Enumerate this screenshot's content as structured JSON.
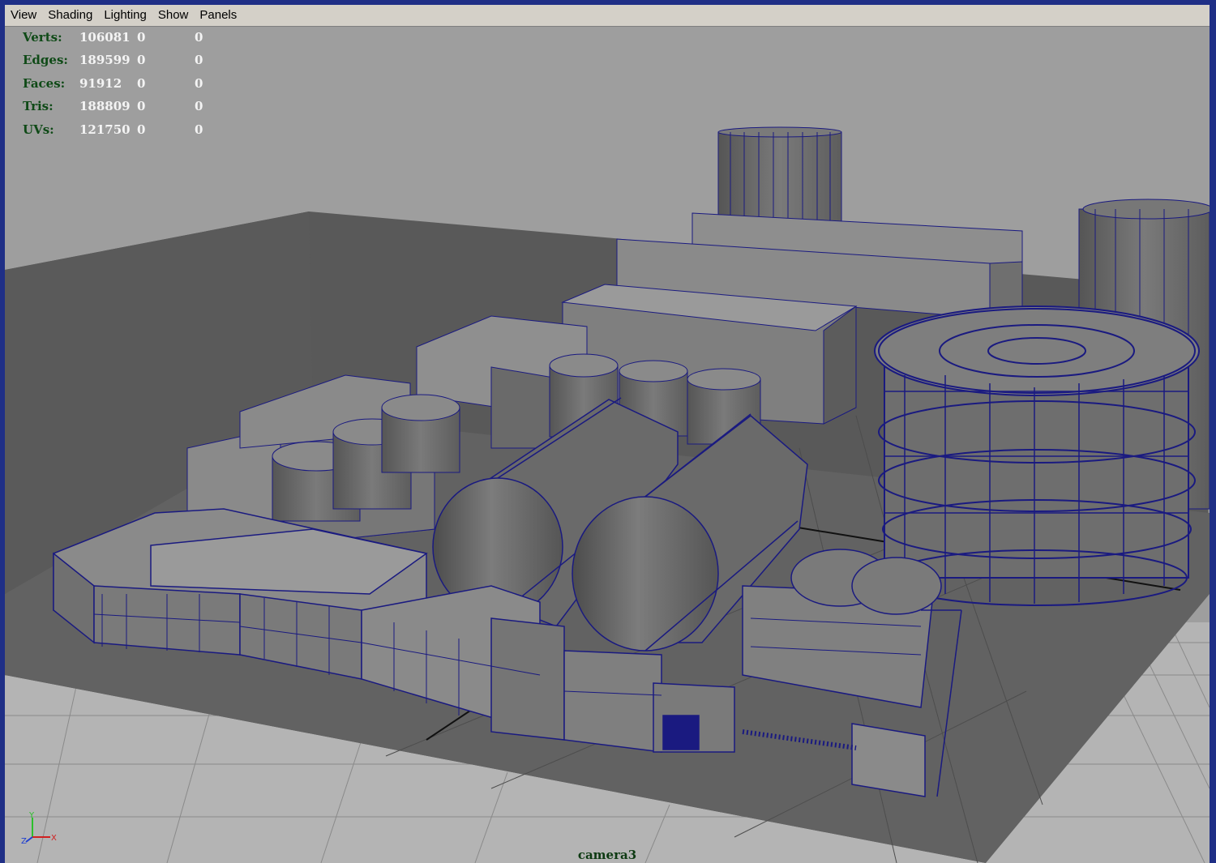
{
  "menubar": {
    "items": [
      "View",
      "Shading",
      "Lighting",
      "Show",
      "Panels"
    ]
  },
  "hud": {
    "rows": [
      {
        "label": "Verts:",
        "v1": "106081",
        "v2": "0",
        "v3": "0"
      },
      {
        "label": "Edges:",
        "v1": "189599",
        "v2": "0",
        "v3": "0"
      },
      {
        "label": "Faces:",
        "v1": "91912",
        "v2": "0",
        "v3": "0"
      },
      {
        "label": "Tris:",
        "v1": "188809",
        "v2": "0",
        "v3": "0"
      },
      {
        "label": "UVs:",
        "v1": "121750",
        "v2": "0",
        "v3": "0"
      }
    ]
  },
  "viewport": {
    "camera": "camera3",
    "axis_labels": {
      "y": "Y",
      "z": "Z",
      "x": "X"
    }
  },
  "colors": {
    "menubar_bg": "#d4d0c8",
    "viewport_bg": "#9e9e9e",
    "wireframe": "#1a1a80",
    "hud_label": "#0f4a17",
    "hud_value": "#f4f4f4",
    "window_border": "#1f2f86"
  }
}
